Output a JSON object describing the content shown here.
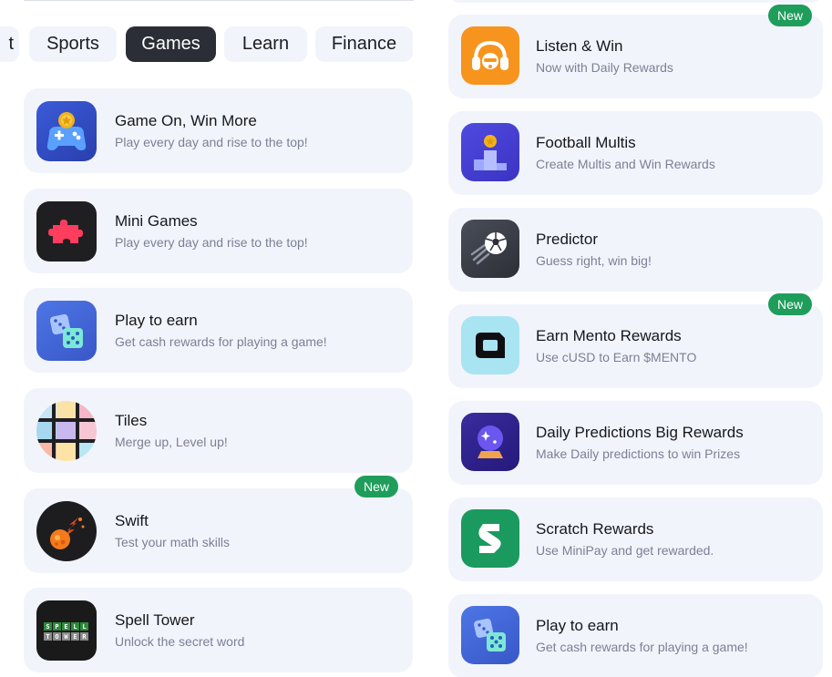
{
  "tabs": {
    "partial_label": "t",
    "items": [
      {
        "label": "Sports",
        "active": false
      },
      {
        "label": "Games",
        "active": true
      },
      {
        "label": "Learn",
        "active": false
      },
      {
        "label": "Finance",
        "active": false
      }
    ]
  },
  "left_cards": [
    {
      "title": "Game On, Win More",
      "subtitle": "Play every day and rise to the top!",
      "icon": "gamepad-coin-icon"
    },
    {
      "title": "Mini Games",
      "subtitle": "Play every day and rise to the top!",
      "icon": "puzzle-piece-icon"
    },
    {
      "title": "Play to earn",
      "subtitle": "Get cash rewards for playing a game!",
      "icon": "dice-icon"
    },
    {
      "title": "Tiles",
      "subtitle": "Merge up, Level up!",
      "icon": "tiles-grid-icon"
    },
    {
      "title": "Swift",
      "subtitle": "Test your math skills",
      "icon": "fireball-icon",
      "badge": "New"
    },
    {
      "title": "Spell Tower",
      "subtitle": "Unlock the secret word",
      "icon": "spell-tower-icon"
    }
  ],
  "right_cards": [
    {
      "title": "Listen & Win",
      "subtitle": "Now with Daily Rewards",
      "icon": "headphones-icon",
      "badge": "New"
    },
    {
      "title": "Football Multis",
      "subtitle": "Create Multis and Win Rewards",
      "icon": "podium-star-icon"
    },
    {
      "title": "Predictor",
      "subtitle": "Guess right, win big!",
      "icon": "soccer-ball-icon"
    },
    {
      "title": "Earn Mento Rewards",
      "subtitle": "Use cUSD to Earn $MENTO",
      "icon": "mento-logo-icon",
      "badge": "New"
    },
    {
      "title": "Daily Predictions Big Rewards",
      "subtitle": "Make Daily predictions to win Prizes",
      "icon": "crystal-ball-icon"
    },
    {
      "title": "Scratch Rewards",
      "subtitle": "Use MiniPay and get rewarded.",
      "icon": "scratch-s-icon"
    },
    {
      "title": "Play to earn",
      "subtitle": "Get cash rewards for playing a game!",
      "icon": "dice-icon"
    }
  ],
  "spell_tower_logo_text": [
    "SPELL",
    "TOWER"
  ],
  "colors": {
    "card_bg": "#f2f4fc",
    "active_tab": "#2b2e36",
    "badge_green": "#1f9d5b",
    "subtitle_gray": "#7b8194"
  }
}
